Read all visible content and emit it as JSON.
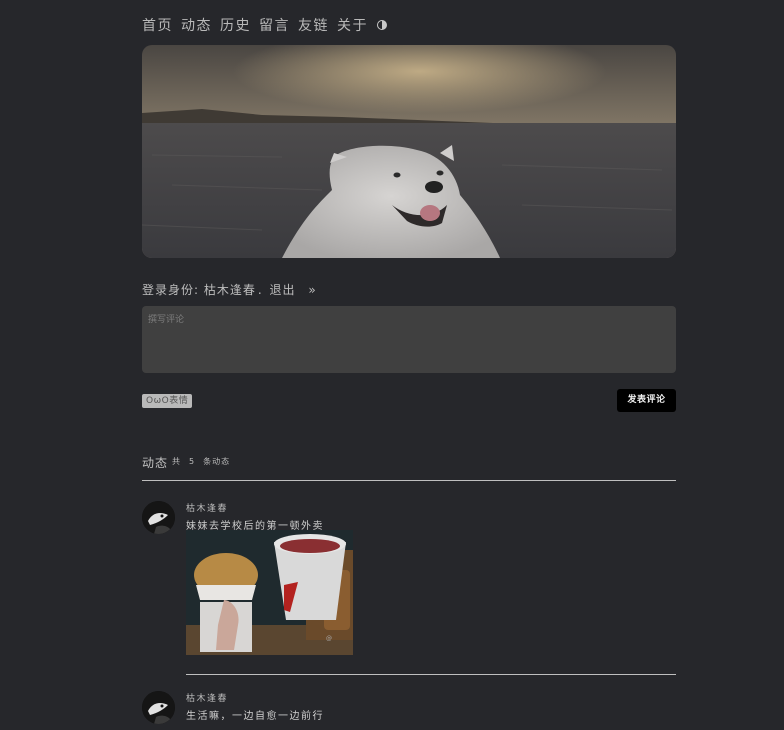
{
  "nav": {
    "items": [
      {
        "label": "首页"
      },
      {
        "label": "动态"
      },
      {
        "label": "历史"
      },
      {
        "label": "留言"
      },
      {
        "label": "友链"
      },
      {
        "label": "关于"
      }
    ],
    "theme_icon": "half-moon-icon"
  },
  "login": {
    "prefix": "登录身份:",
    "user": "枯木逢春",
    "sep": ".",
    "logout": "退出",
    "arrow": "»"
  },
  "comment": {
    "placeholder": "撰写评论",
    "owo_label": "OωO表情",
    "submit_label": "发表评论"
  },
  "feed": {
    "title": "动态",
    "count_prefix": "共",
    "count": "5",
    "count_suffix": "条动态",
    "posts": [
      {
        "author": "枯木逢春",
        "text": "妹妹去学校后的第一顿外卖"
      },
      {
        "author": "枯木逢春",
        "text": "生活嘛，一边自愈一边前行"
      }
    ]
  },
  "colors": {
    "background": "#26272b",
    "input_bg": "#404040",
    "button_bg": "#000000",
    "rule": "#bfbfbf"
  }
}
